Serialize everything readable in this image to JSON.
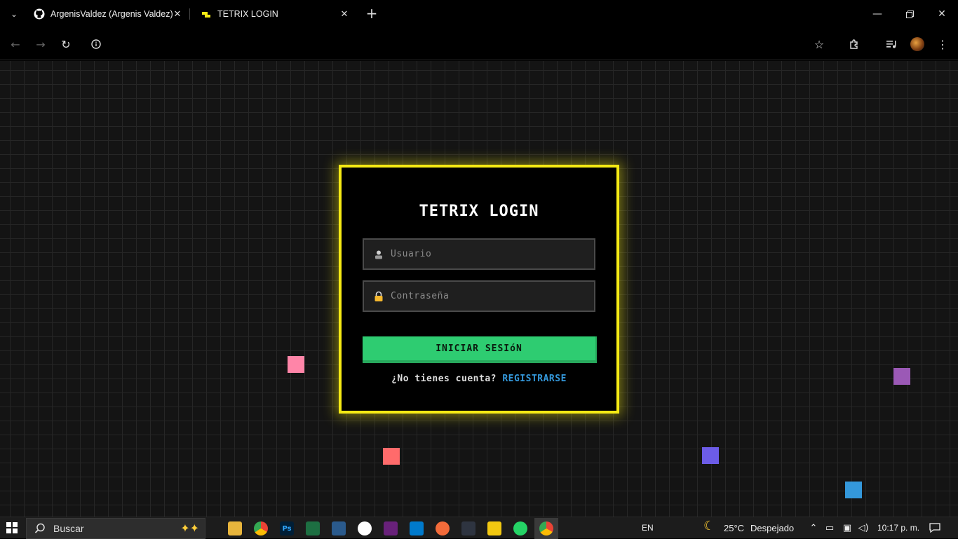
{
  "browser": {
    "tabs": [
      {
        "title": "ArgenisValdez (Argenis Valdez)",
        "favicon": "github-icon"
      },
      {
        "title": "TETRIX LOGIN",
        "favicon": "tetris-block-icon"
      }
    ],
    "new_tab_icon": "plus-icon"
  },
  "login": {
    "title": "TETRIX LOGIN",
    "username_placeholder": "Usuario",
    "password_placeholder": "Contraseña",
    "submit_label": "INICIAR SESIóN",
    "signup_prompt": "¿No tienes cuenta?",
    "signup_link": "REGISTRARSE",
    "colors": {
      "border": "#f5ea14",
      "button": "#2ecc71",
      "link": "#3498db"
    }
  },
  "blocks": [
    {
      "color": "#ff85a8"
    },
    {
      "color": "#ff6b6b"
    },
    {
      "color": "#6c5ce7"
    },
    {
      "color": "#3498db"
    },
    {
      "color": "#9b59b6"
    }
  ],
  "taskbar": {
    "search_placeholder": "Buscar",
    "language": "EN",
    "weather": "25°C",
    "weather_desc": "Despejado",
    "time": "10:17 p. m."
  }
}
